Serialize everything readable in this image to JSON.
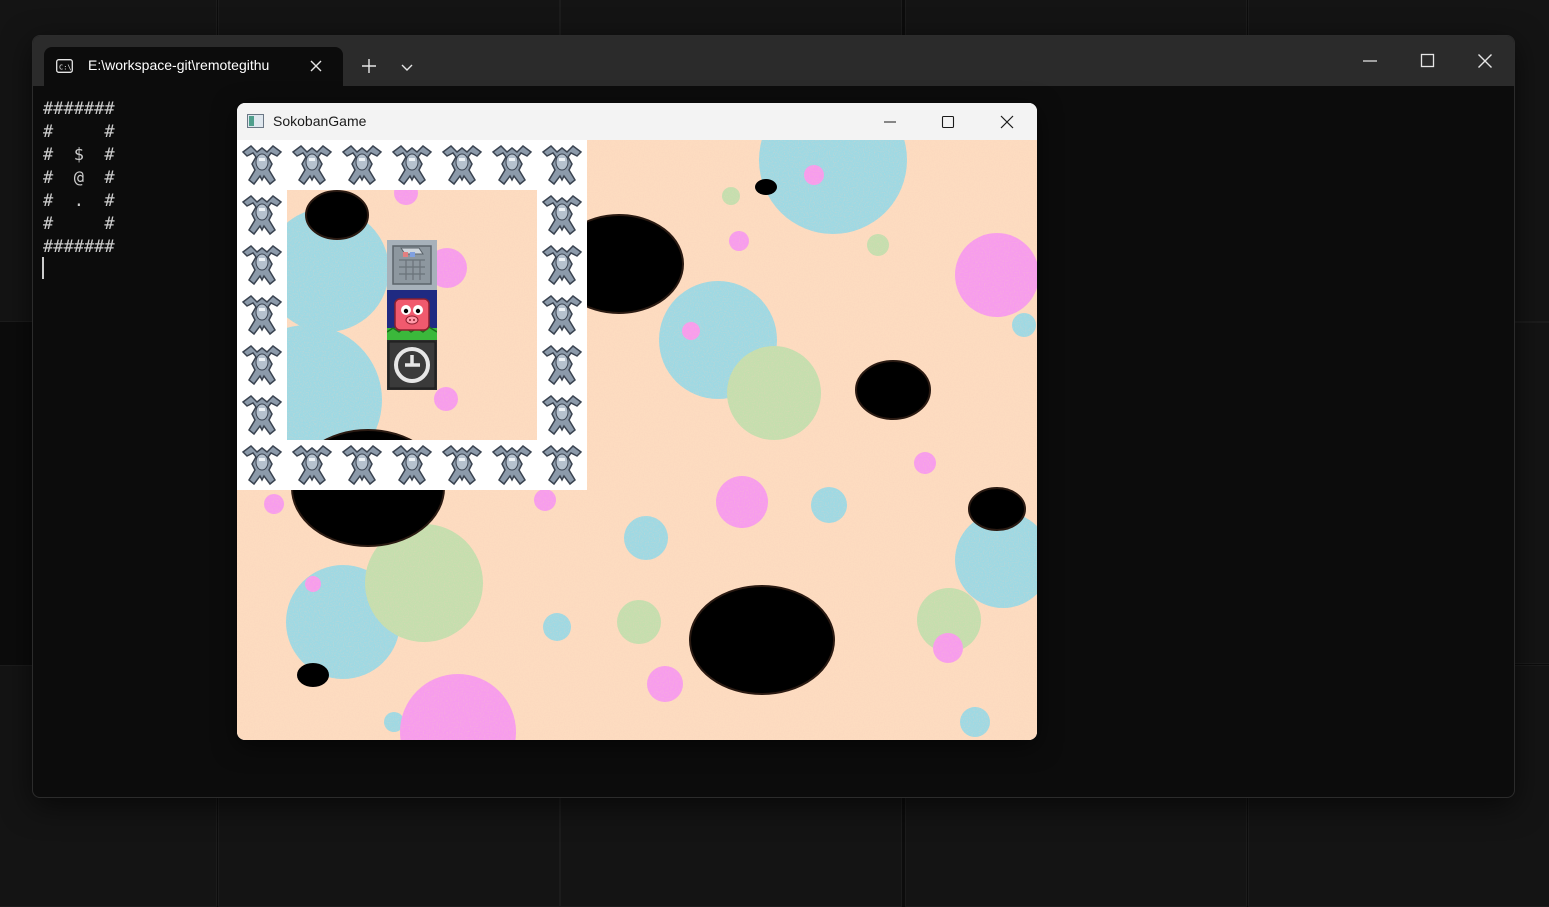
{
  "terminal": {
    "tab_title": "E:\\workspace-git\\remotegithu",
    "tab_icon": "terminal-icon",
    "output_lines": [
      "#######",
      "#     #",
      "#  $  #",
      "#  @  #",
      "#  .  #",
      "#     #",
      "#######"
    ]
  },
  "game_window": {
    "title": "SokobanGame",
    "icon": "app-icon"
  },
  "game": {
    "grid": [
      "WWWWWWW",
      "W     W",
      "W  $  W",
      "W  @  W",
      "W  .  W",
      "W     W",
      "WWWWWWW"
    ],
    "legend": {
      "W": "wall-robot-icon",
      "$": "box-icon",
      "@": "player-pig-icon",
      ".": "goal-target-icon"
    }
  },
  "colors": {
    "background_peach": "#fddcc0",
    "bubble_blue": "#9dd9e4",
    "bubble_pink": "#f79bee",
    "bubble_green": "#c4dfae",
    "hole": "#000000"
  }
}
